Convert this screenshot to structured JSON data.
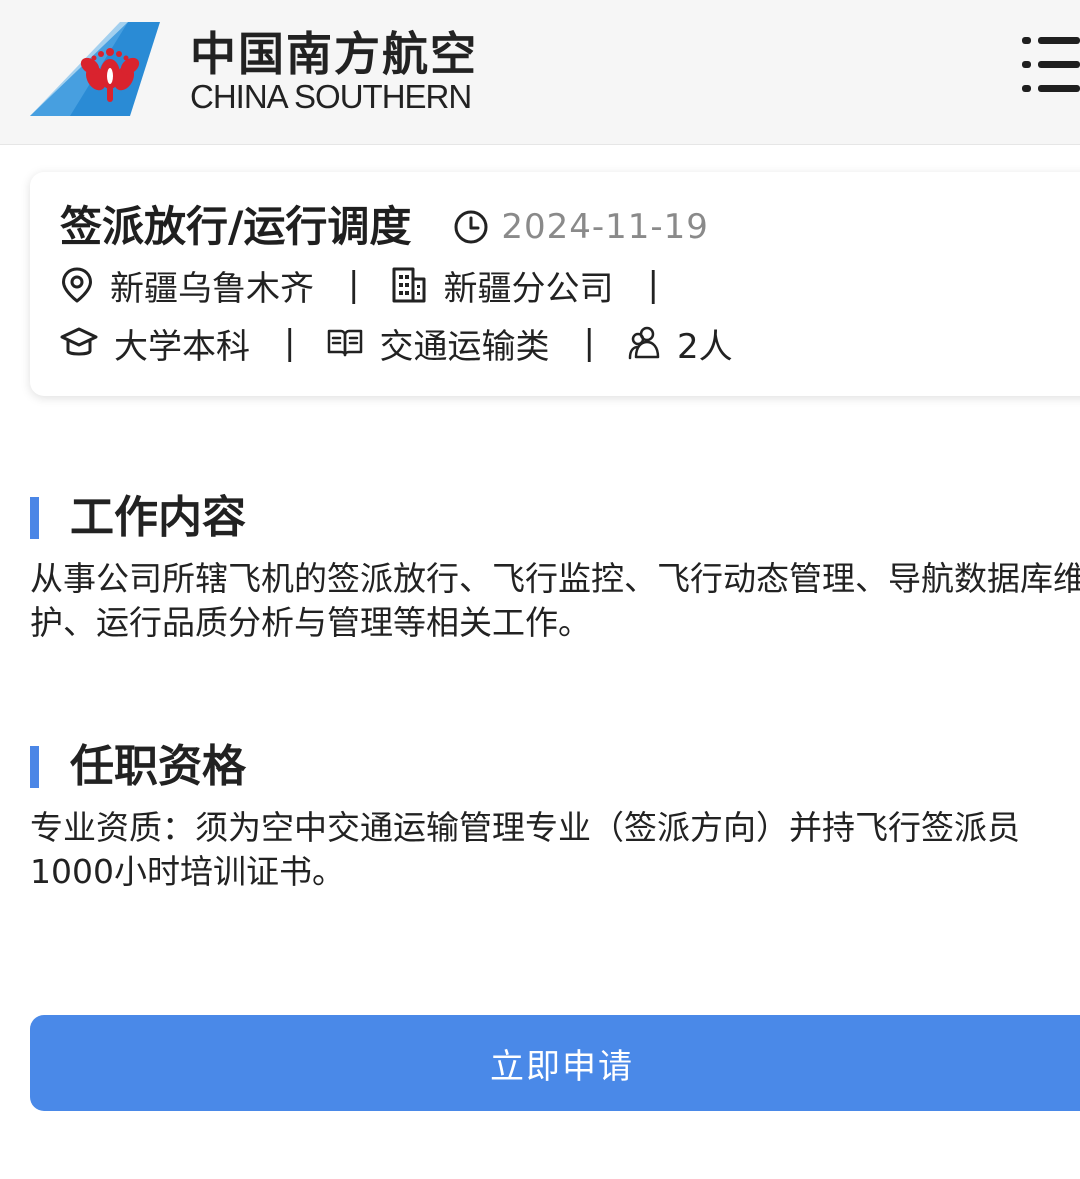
{
  "header": {
    "brand_cn": "中国南方航空",
    "brand_en": "CHINA SOUTHERN",
    "logo_icon": "kapok-flower-icon",
    "menu_icon": "menu-icon",
    "brand_color": "#2a8bd5",
    "logo_accent": "#d9232e"
  },
  "job": {
    "title": "签派放行/运行调度",
    "date": "2024-11-19",
    "location": "新疆乌鲁木齐",
    "company": "新疆分公司",
    "education": "大学本科",
    "major": "交通运输类",
    "headcount": "2人",
    "separator": "|"
  },
  "sections": [
    {
      "title": "工作内容",
      "body": "从事公司所辖飞机的签派放行、飞行监控、飞行动态管理、导航数据库维护、运行品质分析与管理等相关工作。"
    },
    {
      "title": "任职资格",
      "body": "专业资质：须为空中交通运输管理专业（签派方向）并持飞行签派员1000小时培训证书。"
    }
  ],
  "actions": {
    "apply_label": "立即申请",
    "apply_color": "#4a89e8",
    "accent_color": "#4b86e6"
  }
}
